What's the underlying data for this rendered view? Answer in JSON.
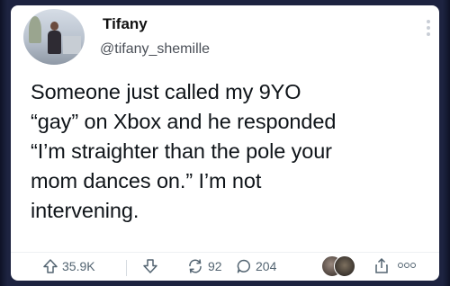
{
  "author": {
    "name": "Tifany",
    "handle": "@tifany_shemille"
  },
  "tweet": {
    "lines": [
      "Someone just called my 9YO",
      "“gay” on Xbox and he responded",
      "“I’m straighter than the pole your",
      "mom dances on.” I’m not",
      "intervening."
    ]
  },
  "actions": {
    "upvote_count": "35.9K",
    "repost_count": "92",
    "reply_count": "204",
    "icons": [
      "upvote-icon",
      "downvote-icon",
      "repost-icon",
      "reply-icon",
      "share-icon",
      "more-icon"
    ]
  },
  "colors": {
    "background": "#1d2340",
    "card": "#ffffff",
    "text": "#0f1419",
    "muted": "#536471"
  }
}
